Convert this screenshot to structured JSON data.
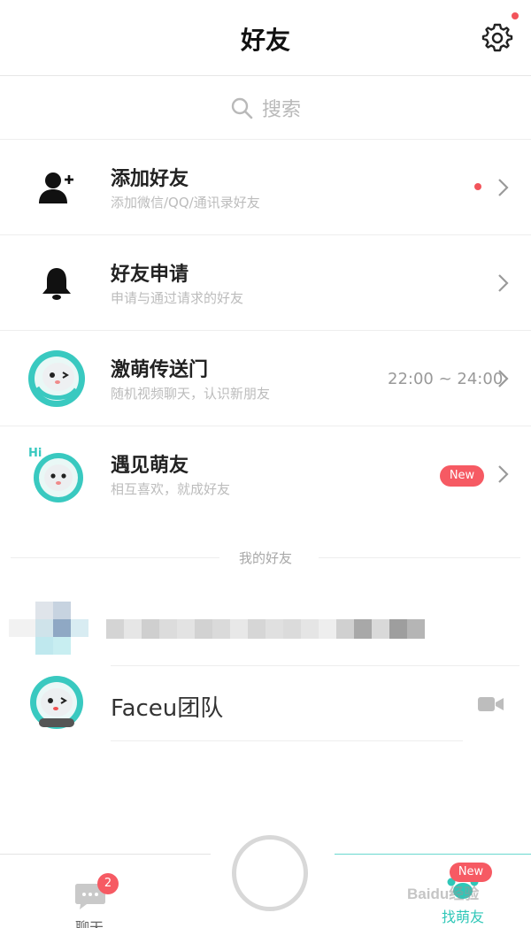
{
  "header": {
    "title": "好友"
  },
  "search": {
    "placeholder": "搜索"
  },
  "menu": [
    {
      "title": "添加好友",
      "subtitle": "添加微信/QQ/通讯录好友",
      "icon": "add-user-icon"
    },
    {
      "title": "好友申请",
      "subtitle": "申请与通过请求的好友",
      "icon": "bell-icon"
    },
    {
      "title": "激萌传送门",
      "subtitle": "随机视频聊天，认识新朋友",
      "time": "22:00 ~ 24:00",
      "icon": "mascot-icon"
    },
    {
      "title": "遇见萌友",
      "subtitle": "相互喜欢，就成好友",
      "badge": "New",
      "icon": "hi-mascot-icon"
    }
  ],
  "friends_section": {
    "label": "我的好友"
  },
  "friends": [
    {
      "name": "Faceu团队"
    }
  ],
  "tabbar": {
    "chat_label": "聊天",
    "chat_badge": "2",
    "friends_label": "找萌友",
    "friends_badge": "New"
  },
  "watermark": "Baidu经验",
  "colors": {
    "accent": "#2fc7b8",
    "badge": "#f65a63",
    "teal_avatar": "#39c9c0"
  }
}
